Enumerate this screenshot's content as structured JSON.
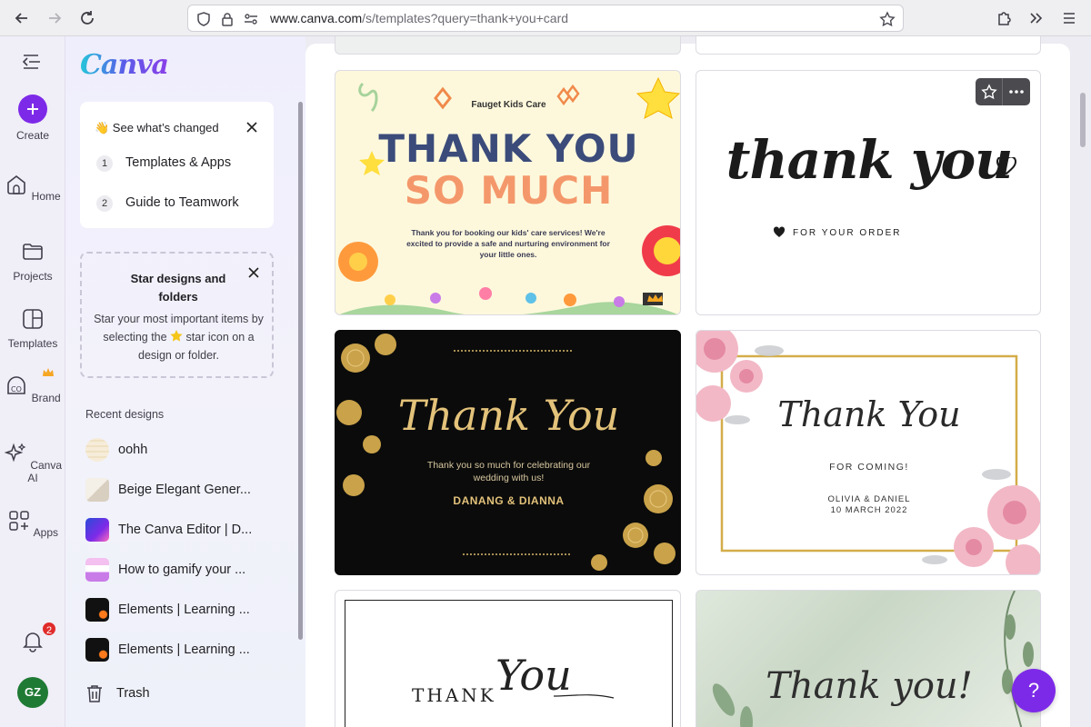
{
  "browser": {
    "url_host": "www.canva.com",
    "url_path": "/s/templates?query=thank+you+card"
  },
  "rail": {
    "items": [
      {
        "label": "Create"
      },
      {
        "label": "Home"
      },
      {
        "label": "Projects"
      },
      {
        "label": "Templates"
      },
      {
        "label": "Brand"
      },
      {
        "label": "Canva AI"
      },
      {
        "label": "Apps"
      }
    ],
    "notification_count": "2",
    "avatar_initials": "GZ"
  },
  "panel": {
    "logo": "Canva",
    "whats_changed": {
      "title": "👋 See what’s changed",
      "steps": [
        {
          "num": "1",
          "label": "Templates & Apps"
        },
        {
          "num": "2",
          "label": "Guide to Teamwork"
        }
      ]
    },
    "star_card": {
      "title": "Star designs and folders",
      "body_before": "Star your most important items by selecting the ",
      "body_after": " star icon on a design or folder."
    },
    "recent_label": "Recent designs",
    "recent": [
      {
        "label": "oohh"
      },
      {
        "label": "Beige Elegant Gener..."
      },
      {
        "label": "The Canva Editor | D..."
      },
      {
        "label": "How to gamify your ..."
      },
      {
        "label": "Elements | Learning ..."
      },
      {
        "label": "Elements | Learning ..."
      }
    ],
    "trash_label": "Trash"
  },
  "templates": {
    "t1": {
      "brand": "Fauget Kids Care",
      "line1": "THANK YOU",
      "line2": "SO MUCH",
      "body": "Thank you for booking our kids' care services! We're excited to provide a safe and nurturing environment for your little ones."
    },
    "t2": {
      "script": "thank you",
      "sub": "FOR YOUR ORDER"
    },
    "t3": {
      "script": "Thank You",
      "body": "Thank you so much for celebrating our wedding with us!",
      "names": "DANANG & DIANNA"
    },
    "t4": {
      "script": "Thank You",
      "sub": "FOR COMING!",
      "names": "OLIVIA & DANIEL",
      "date": "10 MARCH 2022"
    },
    "t5": {
      "word": "THANK",
      "script": "You"
    },
    "t6": {
      "script": "Thank you!"
    }
  },
  "help_label": "?"
}
